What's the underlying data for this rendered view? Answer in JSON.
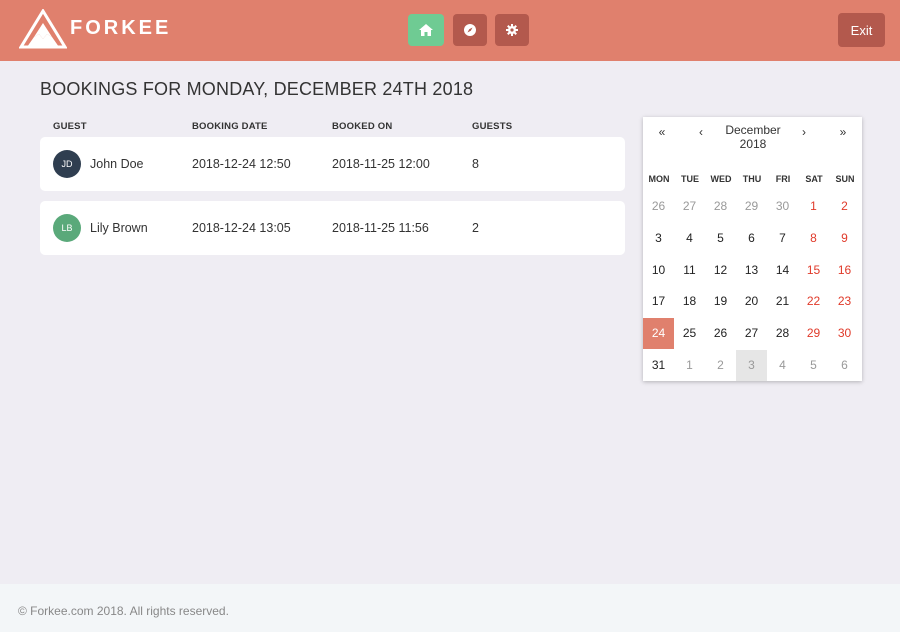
{
  "header": {
    "brand": "FORKEE",
    "nav": [
      {
        "name": "home",
        "icon": "home-icon",
        "active": true
      },
      {
        "name": "explore",
        "icon": "compass-icon",
        "active": false
      },
      {
        "name": "settings",
        "icon": "gear-icon",
        "active": false
      }
    ],
    "exit_label": "Exit"
  },
  "main": {
    "title": "BOOKINGS FOR MONDAY, DECEMBER 24TH 2018",
    "columns": {
      "guest": "GUEST",
      "booking_date": "BOOKING DATE",
      "booked_on": "BOOKED ON",
      "guests": "GUESTS"
    },
    "bookings": [
      {
        "initials": "JD",
        "name": "John Doe",
        "booking_date": "2018-12-24 12:50",
        "booked_on": "2018-11-25 12:00",
        "guests": "8",
        "avatar_color": "#2f3e50"
      },
      {
        "initials": "LB",
        "name": "Lily Brown",
        "booking_date": "2018-12-24 13:05",
        "booked_on": "2018-11-25 11:56",
        "guests": "2",
        "avatar_color": "#5aa97a"
      }
    ]
  },
  "calendar": {
    "prev_year": "«",
    "prev_month": "‹",
    "month": "December",
    "year": "2018",
    "next_month": "›",
    "next_year": "»",
    "weekdays": [
      "MON",
      "TUE",
      "WED",
      "THU",
      "FRI",
      "SAT",
      "SUN"
    ],
    "weeks": [
      [
        "26",
        "27",
        "28",
        "29",
        "30",
        "1",
        "2"
      ],
      [
        "3",
        "4",
        "5",
        "6",
        "7",
        "8",
        "9"
      ],
      [
        "10",
        "11",
        "12",
        "13",
        "14",
        "15",
        "16"
      ],
      [
        "17",
        "18",
        "19",
        "20",
        "21",
        "22",
        "23"
      ],
      [
        "24",
        "25",
        "26",
        "27",
        "28",
        "29",
        "30"
      ],
      [
        "31",
        "1",
        "2",
        "3",
        "4",
        "5",
        "6"
      ]
    ],
    "selected": "2018-12-24",
    "today": "2019-01-03"
  },
  "footer": {
    "text": "© Forkee.com 2018. All rights reserved."
  },
  "colors": {
    "brand": "#e0806d",
    "nav_active": "#6fcb93",
    "nav_inactive": "#b3594d",
    "weekend": "#e03a2a",
    "selected": "#e0806d",
    "outside_month": "#999999",
    "today_bg": "#e6e6e6"
  }
}
